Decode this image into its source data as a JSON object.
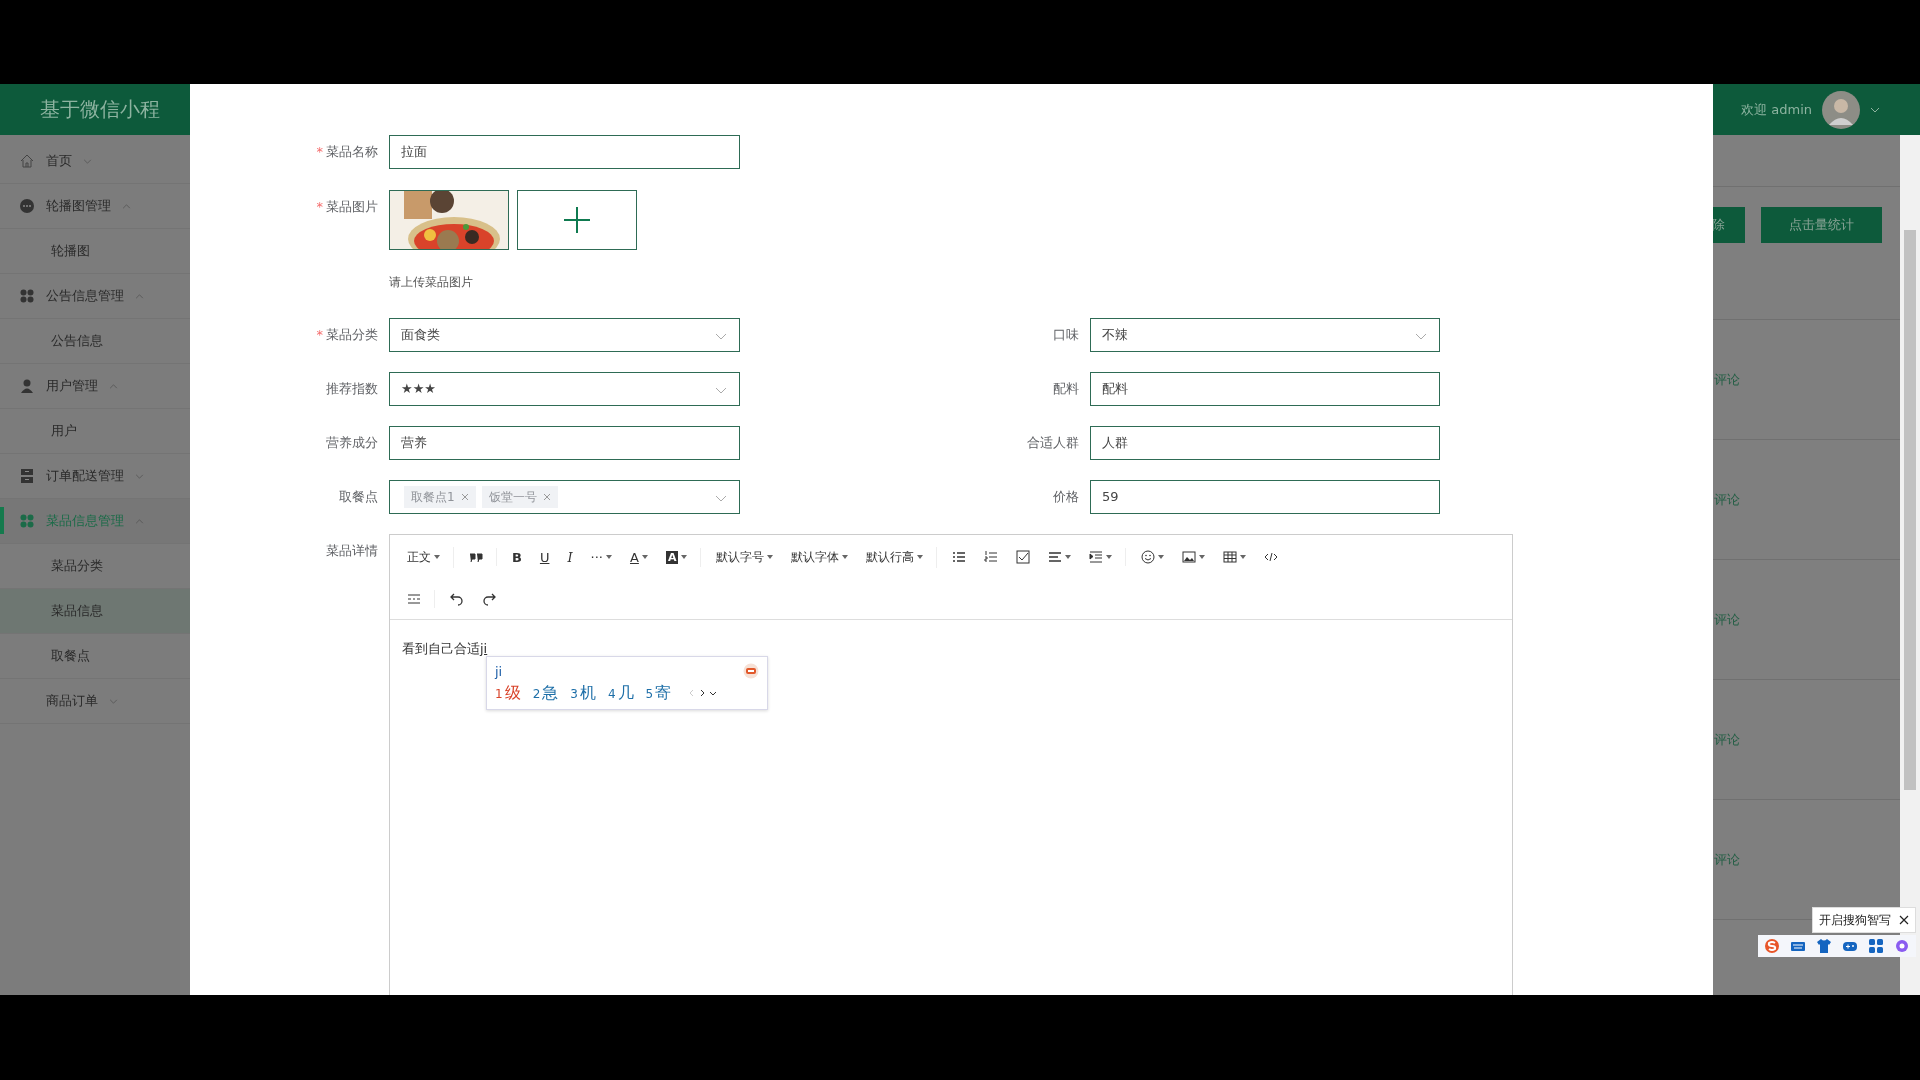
{
  "header": {
    "title": "基于微信小程",
    "welcome": "欢迎 admin"
  },
  "sidebar": {
    "items": [
      {
        "label": "首页",
        "expanded": false,
        "selected": false
      },
      {
        "label": "轮播图管理",
        "expanded": true,
        "selected": false,
        "children": [
          {
            "label": "轮播图",
            "selected": false
          }
        ]
      },
      {
        "label": "公告信息管理",
        "expanded": true,
        "selected": false,
        "children": [
          {
            "label": "公告信息",
            "selected": false
          }
        ]
      },
      {
        "label": "用户管理",
        "expanded": true,
        "selected": false,
        "children": [
          {
            "label": "用户",
            "selected": false
          }
        ]
      },
      {
        "label": "订单配送管理",
        "expanded": false,
        "selected": false
      },
      {
        "label": "菜品信息管理",
        "expanded": true,
        "selected": true,
        "children": [
          {
            "label": "菜品分类",
            "selected": false
          },
          {
            "label": "菜品信息",
            "selected": true
          },
          {
            "label": "取餐点",
            "selected": false
          }
        ]
      },
      {
        "label": "商品订单",
        "expanded": false,
        "selected": false
      }
    ]
  },
  "background": {
    "buttons": [
      "除",
      "点击量统计"
    ],
    "rows": [
      {
        "link": "评论"
      },
      {
        "link": "评论"
      },
      {
        "link": "评论"
      },
      {
        "link": "评论"
      },
      {
        "link": "评论"
      }
    ]
  },
  "form": {
    "name": {
      "label": "菜品名称",
      "mark": "*",
      "value": "拉面"
    },
    "images": {
      "label": "菜品图片",
      "mark": "*",
      "hint": "请上传菜品图片"
    },
    "rows": [
      [
        {
          "label": "菜品分类",
          "mark": "*",
          "kind": "select",
          "value": "面食类"
        },
        {
          "label": "口味",
          "kind": "select",
          "value": "不辣"
        }
      ],
      [
        {
          "label": "推荐指数",
          "kind": "select",
          "value": "★★★"
        },
        {
          "label": "配料",
          "kind": "input",
          "value": "配料"
        }
      ],
      [
        {
          "label": "营养成分",
          "kind": "input",
          "value": "营养"
        },
        {
          "label": "合适人群",
          "kind": "input",
          "value": "人群"
        }
      ],
      [
        {
          "label": "取餐点",
          "kind": "tags",
          "tags": [
            "取餐点1",
            "饭堂一号"
          ]
        },
        {
          "label": "价格",
          "kind": "input",
          "value": "59"
        }
      ]
    ],
    "editor": {
      "label": "菜品详情",
      "rows": [
        [
          [
            {
              "kind": "text",
              "label": "正文",
              "dropdown": true
            }
          ],
          [
            {
              "kind": "icon",
              "dropdown": false
            }
          ],
          [
            {
              "kind": "glyph",
              "label": "B",
              "dropdown": false
            },
            {
              "kind": "glyph",
              "label": "U",
              "dropdown": false
            },
            {
              "kind": "glyph",
              "label": "I",
              "dropdown": false
            },
            {
              "kind": "glyph",
              "label": "···",
              "dropdown": true
            },
            {
              "kind": "glyph",
              "label": "A",
              "dropdown": true
            },
            {
              "kind": "glyph",
              "label": "A",
              "dropdown": true
            }
          ],
          [
            {
              "kind": "text",
              "label": "默认字号",
              "dropdown": true
            },
            {
              "kind": "text",
              "label": "默认字体",
              "dropdown": true
            },
            {
              "kind": "text",
              "label": "默认行高",
              "dropdown": true
            }
          ],
          [
            {
              "kind": "icon",
              "dropdown": false
            },
            {
              "kind": "icon",
              "dropdown": false
            },
            {
              "kind": "icon",
              "dropdown": false
            },
            {
              "kind": "icon",
              "dropdown": true
            },
            {
              "kind": "icon",
              "dropdown": true
            }
          ],
          [
            {
              "kind": "icon",
              "dropdown": true
            },
            {
              "kind": "icon",
              "dropdown": true
            },
            {
              "kind": "icon",
              "dropdown": true
            },
            {
              "kind": "icon",
              "dropdown": false
            }
          ]
        ],
        [
          [
            {
              "kind": "icon",
              "dropdown": false
            }
          ],
          [
            {
              "kind": "icon",
              "dropdown": false
            },
            {
              "kind": "icon",
              "dropdown": false
            }
          ]
        ]
      ],
      "content": "看到自己合适",
      "composing": "ji"
    }
  },
  "ime": {
    "composition": "ji",
    "candidates": [
      {
        "index": "1",
        "text": "级",
        "selected": true
      },
      {
        "index": "2",
        "text": "急",
        "selected": false
      },
      {
        "index": "3",
        "text": "机",
        "selected": false
      },
      {
        "index": "4",
        "text": "几",
        "selected": false
      },
      {
        "index": "5",
        "text": "寄",
        "selected": false
      }
    ]
  },
  "ime_bar": {
    "tip": "开启搜狗智写"
  }
}
